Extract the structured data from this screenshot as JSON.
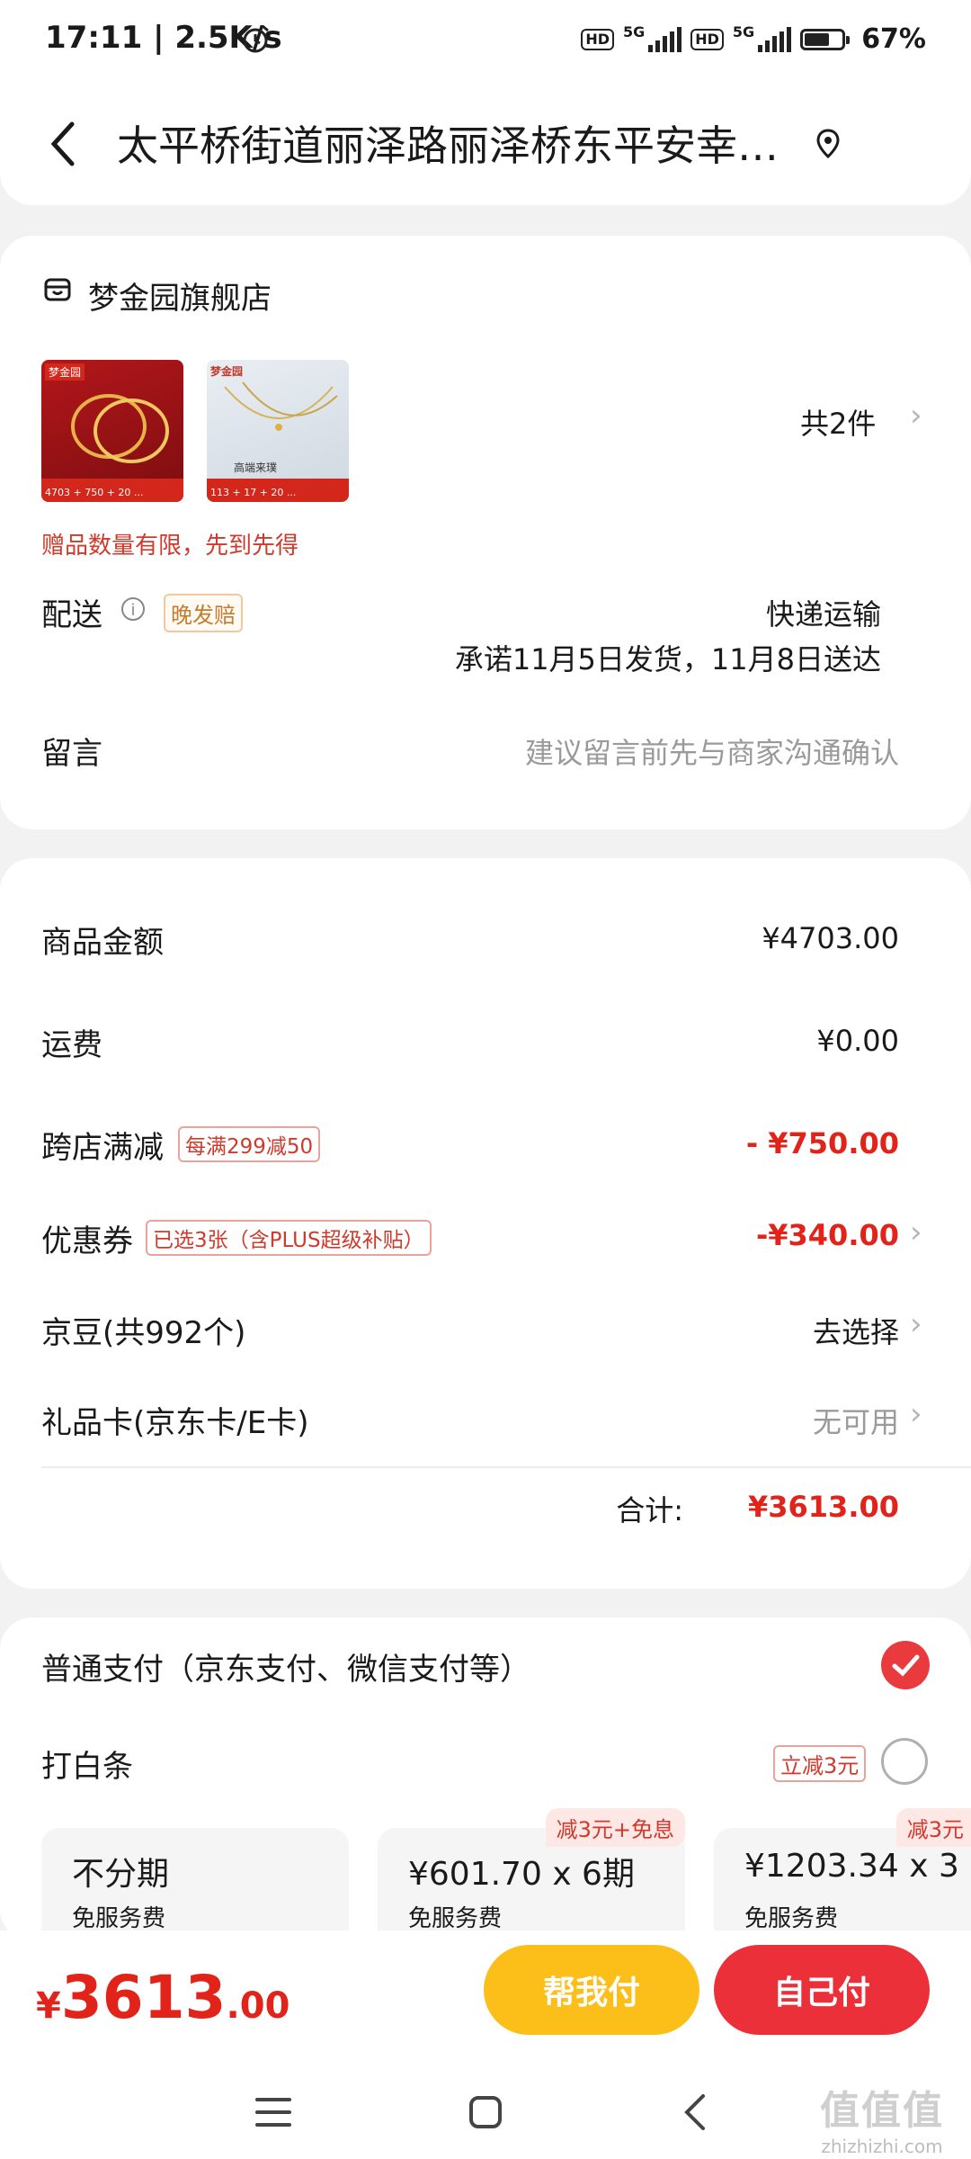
{
  "status_bar": {
    "time": "17:11 | 2.5K/s",
    "battery": "67%",
    "battery_level": 0.67
  },
  "header": {
    "address": "太平桥街道丽泽路丽泽桥东平安幸…"
  },
  "shop": {
    "name": "梦金园旗舰店",
    "item_count": "共2件",
    "gift_tip": "赠品数量有限，先到先得",
    "thumb1": {
      "brand": "梦金园",
      "bottom": "4703 + 750 + 20 ..."
    },
    "thumb2": {
      "brand": "梦金园",
      "caption": "高端来璞",
      "bottom": "113 + 17 + 20 ..."
    }
  },
  "delivery": {
    "label": "配送",
    "tag": "晚发赔",
    "method": "快递运输",
    "promise": "承诺11月5日发货，11月8日送达"
  },
  "message": {
    "label": "留言",
    "placeholder": "建议留言前先与商家沟通确认"
  },
  "summary": {
    "goods_label": "商品金额",
    "goods_value": "¥4703.00",
    "shipping_label": "运费",
    "shipping_value": "¥0.00",
    "cross_label": "跨店满减",
    "cross_tag": "每满299减50",
    "cross_value": "- ¥750.00",
    "coupon_label": "优惠券",
    "coupon_tag": "已选3张（含PLUS超级补贴）",
    "coupon_value": "-¥340.00",
    "jd_bean_label": "京豆(共992个)",
    "jd_bean_value": "去选择",
    "giftcard_label": "礼品卡(京东卡/E卡)",
    "giftcard_value": "无可用",
    "total_label": "合计:",
    "total_value": "¥3613.00"
  },
  "payment": {
    "normal_label": "普通支付（京东支付、微信支付等）",
    "baitiao_label": "打白条",
    "baitiao_tag": "立减3元",
    "plans": [
      {
        "main": "不分期",
        "sub": "免服务费",
        "promo": ""
      },
      {
        "main": "¥601.70 x 6期",
        "sub": "免服务费",
        "promo": "减3元+免息"
      },
      {
        "main": "¥1203.34 x 3",
        "sub": "免服务费",
        "promo": "减3元"
      }
    ]
  },
  "bottom": {
    "currency": "¥",
    "amount_int": "3613",
    "amount_dec": ".00",
    "help_pay": "帮我付",
    "self_pay": "自己付"
  },
  "watermark": {
    "line1": "值值值",
    "line2": "zhizhizhi.com"
  }
}
